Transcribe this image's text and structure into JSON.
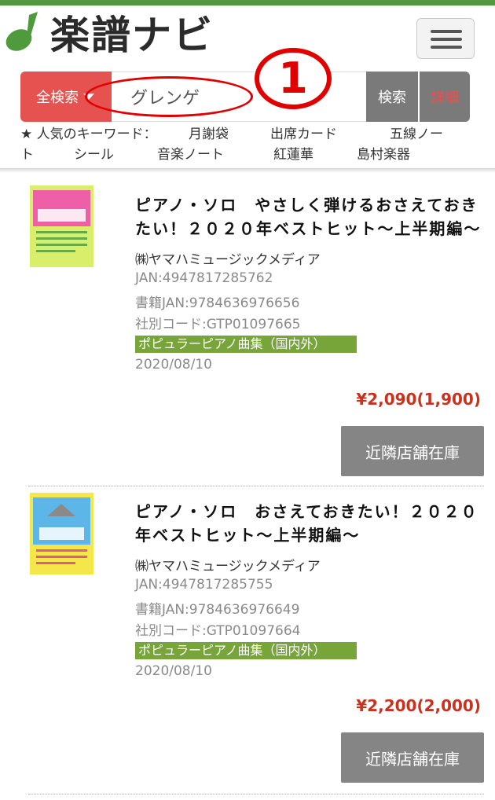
{
  "colors": {
    "brand_green": "#4f9a3c",
    "accent_red": "#e5524f",
    "genre_green": "#77a53a",
    "price_red": "#c8321e",
    "button_gray": "#858585"
  },
  "header": {
    "logo_text": "楽譜ナビ",
    "menu_icon": "hamburger-icon"
  },
  "search": {
    "scope_label": "全検索",
    "query": "グレンゲ",
    "search_label": "検索",
    "detail_label": "詳細",
    "annotation_number": "①"
  },
  "keywords": {
    "label": "★ 人気のキーワード：",
    "row1": [
      "月謝袋",
      "出席カード",
      "五線ノー"
    ],
    "row2": [
      "ト",
      "シール",
      "音楽ノート",
      "紅蓮華",
      "島村楽器"
    ]
  },
  "products": [
    {
      "title_line1": "ピアノ・ソロ　やさしく弾けるおさえておき",
      "title_line2": "たい！２０２０年ベストヒット〜上半期編〜",
      "publisher": "㈱ヤマハミュージックメディア",
      "jan": "JAN:4947817285762",
      "book_jan": "書籍JAN:9784636976656",
      "code": "社別コード:GTP01097665",
      "genre": "ポピュラーピアノ曲集（国内外）",
      "date": "2020/08/10",
      "price": "¥2,090(1,900)",
      "stock_label": "近隣店舗在庫"
    },
    {
      "title_line1": "ピアノ・ソロ　おさえておきたい！２０２０",
      "title_line2": "年ベストヒット〜上半期編〜",
      "publisher": "㈱ヤマハミュージックメディア",
      "jan": "JAN:4947817285755",
      "book_jan": "書籍JAN:9784636976649",
      "code": "社別コード:GTP01097664",
      "genre": "ポピュラーピアノ曲集（国内外）",
      "date": "2020/08/10",
      "price": "¥2,200(2,000)",
      "stock_label": "近隣店舗在庫"
    }
  ]
}
